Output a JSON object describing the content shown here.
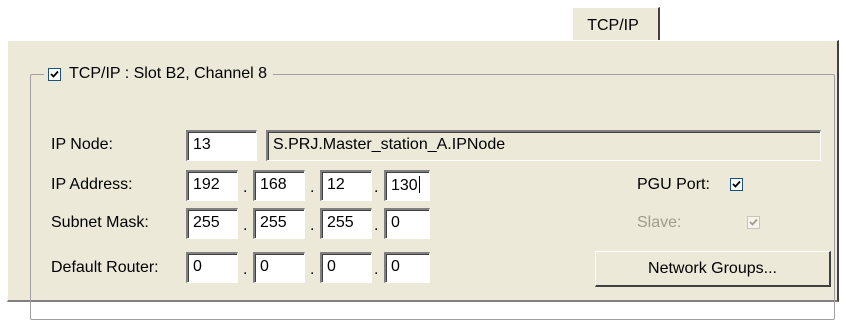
{
  "tab": {
    "label": "TCP/IP"
  },
  "group": {
    "checkbox_checked": true,
    "title": "TCP/IP : Slot B2, Channel 8"
  },
  "ip_node": {
    "label": "IP Node:",
    "number": "13",
    "name": "S.PRJ.Master_station_A.IPNode"
  },
  "ip_address": {
    "label": "IP Address:",
    "octets": [
      "192",
      "168",
      "12",
      "130"
    ]
  },
  "subnet_mask": {
    "label": "Subnet Mask:",
    "octets": [
      "255",
      "255",
      "255",
      "0"
    ]
  },
  "default_router": {
    "label": "Default Router:",
    "octets": [
      "0",
      "0",
      "0",
      "0"
    ]
  },
  "separator": ".",
  "pgu_port": {
    "label": "PGU Port:",
    "checked": true
  },
  "slave": {
    "label": "Slave:",
    "checked": true,
    "enabled": false
  },
  "network_groups_button": {
    "label": "Network Groups..."
  },
  "colors": {
    "panel_bg": "#ece9d8",
    "disabled_text": "#a09c8c",
    "check_mark": "#000000"
  }
}
